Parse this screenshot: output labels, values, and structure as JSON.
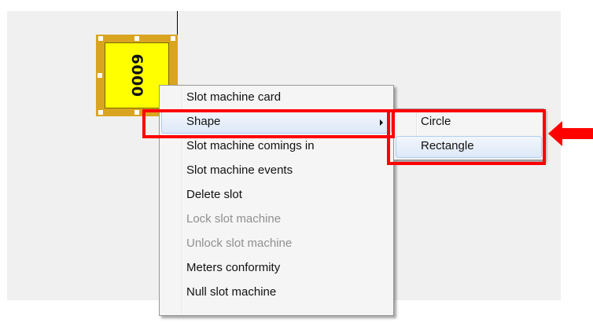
{
  "slot_machine": {
    "number": "6000"
  },
  "context_menu": {
    "items": [
      {
        "label": "Slot machine card",
        "enabled": true
      },
      {
        "label": "Shape",
        "enabled": true,
        "has_submenu": true,
        "highlighted": true
      },
      {
        "label": "Slot machine comings in",
        "enabled": true
      },
      {
        "label": "Slot machine events",
        "enabled": true
      },
      {
        "label": "Delete slot",
        "enabled": true
      },
      {
        "label": "Lock slot machine",
        "enabled": false
      },
      {
        "label": "Unlock slot machine",
        "enabled": false
      },
      {
        "label": "Meters conformity",
        "enabled": true
      },
      {
        "label": "Null slot machine",
        "enabled": true
      }
    ]
  },
  "shape_submenu": {
    "items": [
      {
        "label": "Circle"
      },
      {
        "label": "Rectangle",
        "highlighted": true
      }
    ]
  },
  "annotation": {
    "highlight_color": "#ff0000"
  }
}
